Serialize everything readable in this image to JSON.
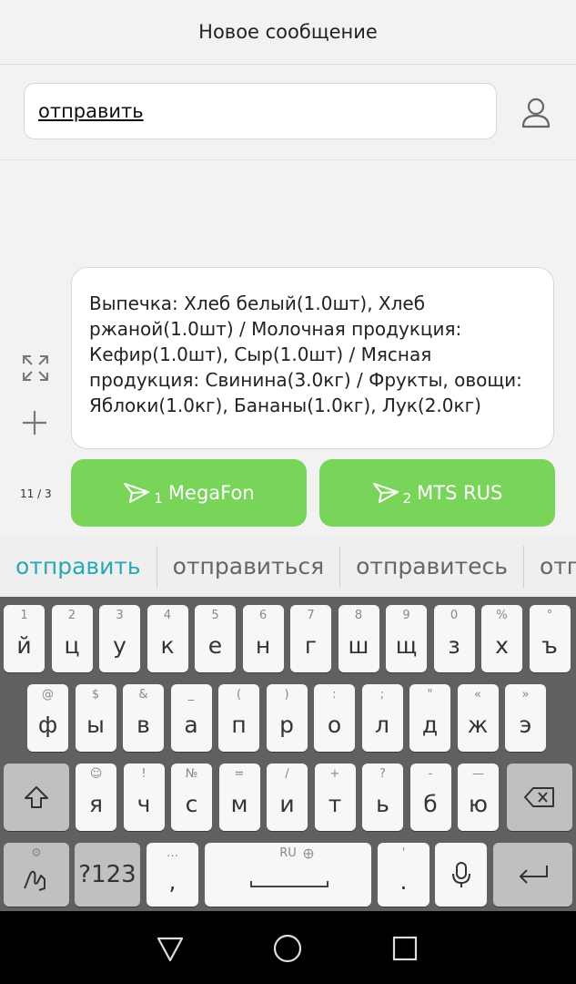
{
  "header": {
    "title": "Новое сообщение"
  },
  "recipient": {
    "value": "отправить"
  },
  "message": {
    "text": "Выпечка: Хлеб белый(1.0шт), Хлеб ржаной(1.0шт)  / Молочная продукция: Кефир(1.0шт), Сыр(1.0шт)  / Мясная продукция: Свинина(3.0кг)  / Фрукты, овощи: Яблоки(1.0кг), Бананы(1.0кг), Лук(2.0кг)"
  },
  "counter": "11 / 3",
  "send_buttons": [
    {
      "sim": "1",
      "label": "MegaFon"
    },
    {
      "sim": "2",
      "label": "MTS RUS"
    }
  ],
  "suggestions": [
    "отправить",
    "отправиться",
    "отправитесь",
    "отпр"
  ],
  "keyboard": {
    "row1": [
      {
        "hint": "1",
        "key": "й"
      },
      {
        "hint": "2",
        "key": "ц"
      },
      {
        "hint": "3",
        "key": "у"
      },
      {
        "hint": "4",
        "key": "к"
      },
      {
        "hint": "5",
        "key": "е"
      },
      {
        "hint": "6",
        "key": "н"
      },
      {
        "hint": "7",
        "key": "г"
      },
      {
        "hint": "8",
        "key": "ш"
      },
      {
        "hint": "9",
        "key": "щ"
      },
      {
        "hint": "0",
        "key": "з"
      },
      {
        "hint": "%",
        "key": "х"
      },
      {
        "hint": "°",
        "key": "ъ"
      }
    ],
    "row2": [
      {
        "hint": "@",
        "key": "ф"
      },
      {
        "hint": "$",
        "key": "ы"
      },
      {
        "hint": "&",
        "key": "в"
      },
      {
        "hint": "_",
        "key": "а"
      },
      {
        "hint": "(",
        "key": "п"
      },
      {
        "hint": ")",
        "key": "р"
      },
      {
        "hint": ":",
        "key": "о"
      },
      {
        "hint": ";",
        "key": "л"
      },
      {
        "hint": "\"",
        "key": "д"
      },
      {
        "hint": "«",
        "key": "ж"
      },
      {
        "hint": "»",
        "key": "э"
      }
    ],
    "row3": [
      {
        "hint": "☺",
        "key": "я"
      },
      {
        "hint": "!",
        "key": "ч"
      },
      {
        "hint": "№",
        "key": "с"
      },
      {
        "hint": "=",
        "key": "м"
      },
      {
        "hint": "/",
        "key": "и"
      },
      {
        "hint": "+",
        "key": "т"
      },
      {
        "hint": "?",
        "key": "ь"
      },
      {
        "hint": "-",
        "key": "б"
      },
      {
        "hint": "—",
        "key": "ю"
      }
    ],
    "symbols_label": "?123",
    "comma": {
      "hint": "…",
      "key": ","
    },
    "space_label": "RU",
    "period": {
      "hint": "'",
      "key": "."
    }
  }
}
